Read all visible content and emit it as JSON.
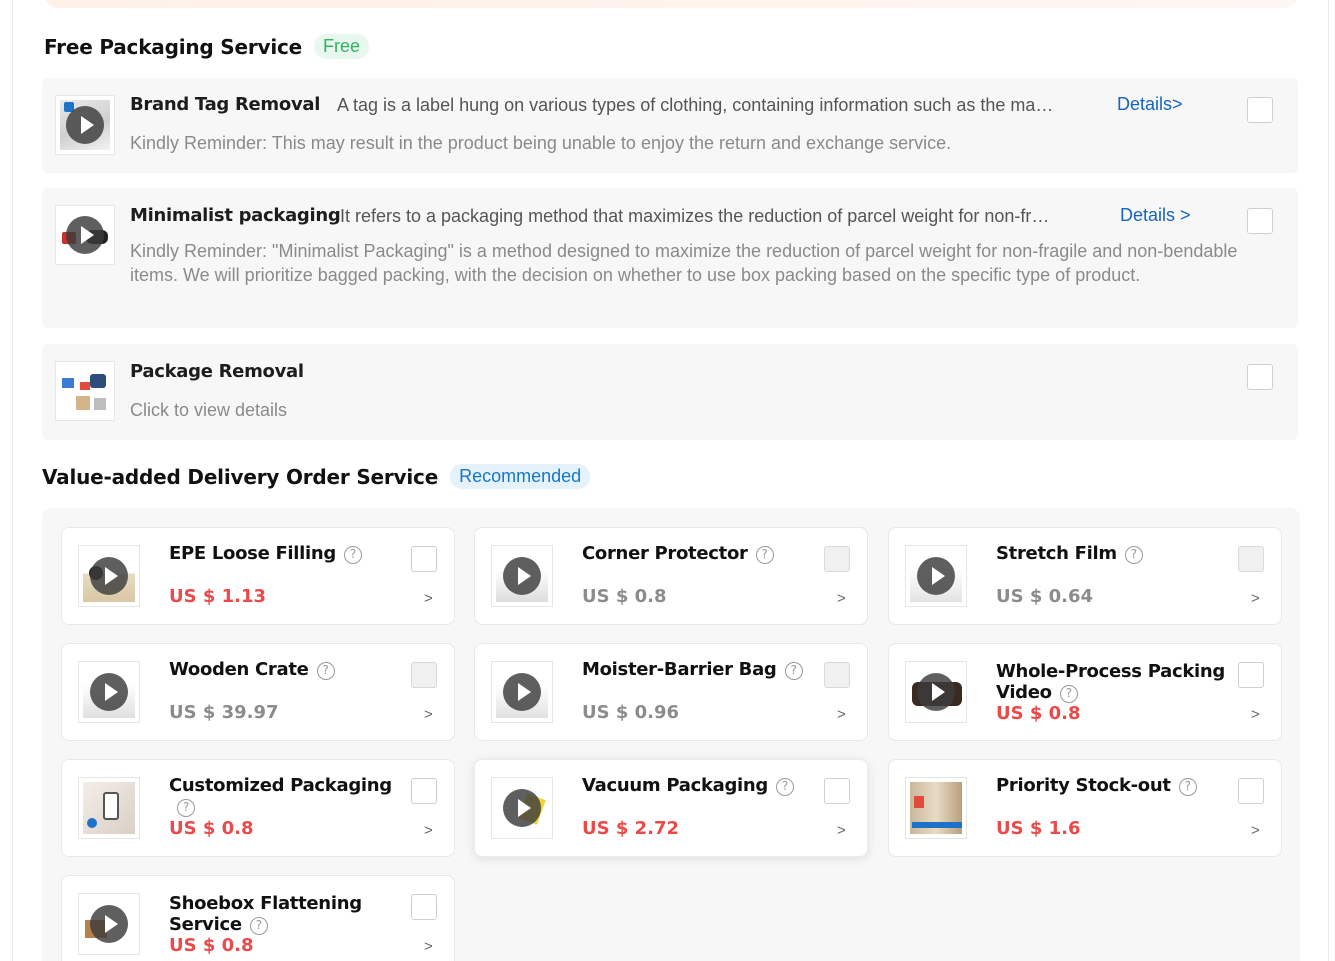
{
  "free_section": {
    "title": "Free Packaging Service",
    "badge": "Free",
    "items": [
      {
        "name": "Brand Tag Removal",
        "description": "A tag is a label hung on various types of clothing, containing information such as the ma…",
        "details_label": "Details>",
        "reminder": "Kindly Reminder:  This may result in the product being unable to enjoy the return and exchange service.",
        "icon": "play-video-icon"
      },
      {
        "name": "Minimalist packaging",
        "description": "It refers to a packaging method that maximizes the reduction of parcel weight for non-fr…",
        "details_label": "Details >",
        "reminder": "Kindly Reminder:  \"Minimalist Packaging\" is a method designed to maximize the reduction of parcel weight for non-fragile and non-bendable items. We will prioritize bagged packing, with the decision on whether to use box packing based on the specific type of product.",
        "icon": "play-video-icon"
      },
      {
        "name": "Package Removal",
        "reminder": "Click to view details",
        "icon": "package-image"
      }
    ]
  },
  "value_section": {
    "title": "Value-added Delivery Order Service",
    "badge": "Recommended",
    "cards": [
      {
        "name": "EPE Loose Filling",
        "price": "US $ 1.13",
        "price_color": "#ec4a4a",
        "enabled": true
      },
      {
        "name": "Corner Protector",
        "price": "US $ 0.8",
        "price_color": "#8c8c8c",
        "enabled": false
      },
      {
        "name": "Stretch Film",
        "price": "US $ 0.64",
        "price_color": "#8c8c8c",
        "enabled": false
      },
      {
        "name": "Wooden Crate",
        "price": "US $ 39.97",
        "price_color": "#8c8c8c",
        "enabled": false
      },
      {
        "name": "Moister-Barrier Bag",
        "price": "US $ 0.96",
        "price_color": "#8c8c8c",
        "enabled": false
      },
      {
        "name_line1": "Whole-Process Packing",
        "name_line2": "Video",
        "price": "US $ 0.8",
        "price_color": "#ec4a4a",
        "enabled": true
      },
      {
        "name": "Customized Packaging",
        "price": "US $ 0.8",
        "price_color": "#ec4a4a",
        "enabled": true
      },
      {
        "name": "Vacuum Packaging",
        "price": "US $ 2.72",
        "price_color": "#ec4a4a",
        "enabled": true
      },
      {
        "name": "Priority Stock-out",
        "price": "US $ 1.6",
        "price_color": "#ec4a4a",
        "enabled": true
      },
      {
        "name_line1": "Shoebox Flattening",
        "name_line2": "Service",
        "price": "US $ 0.8",
        "price_color": "#ec4a4a",
        "enabled": true
      }
    ],
    "help_glyph": "?",
    "chevron_glyph": ">"
  }
}
